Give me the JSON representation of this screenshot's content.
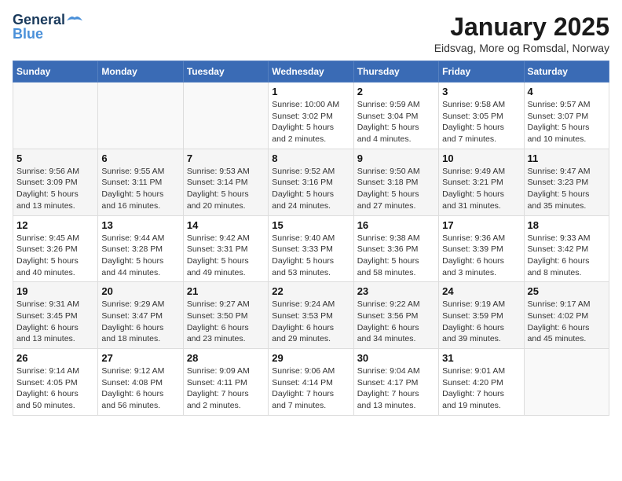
{
  "header": {
    "logo_line1": "General",
    "logo_line2": "Blue",
    "title": "January 2025",
    "subtitle": "Eidsvag, More og Romsdal, Norway"
  },
  "weekdays": [
    "Sunday",
    "Monday",
    "Tuesday",
    "Wednesday",
    "Thursday",
    "Friday",
    "Saturday"
  ],
  "weeks": [
    [
      {
        "day": "",
        "info": ""
      },
      {
        "day": "",
        "info": ""
      },
      {
        "day": "",
        "info": ""
      },
      {
        "day": "1",
        "info": "Sunrise: 10:00 AM\nSunset: 3:02 PM\nDaylight: 5 hours\nand 2 minutes."
      },
      {
        "day": "2",
        "info": "Sunrise: 9:59 AM\nSunset: 3:04 PM\nDaylight: 5 hours\nand 4 minutes."
      },
      {
        "day": "3",
        "info": "Sunrise: 9:58 AM\nSunset: 3:05 PM\nDaylight: 5 hours\nand 7 minutes."
      },
      {
        "day": "4",
        "info": "Sunrise: 9:57 AM\nSunset: 3:07 PM\nDaylight: 5 hours\nand 10 minutes."
      }
    ],
    [
      {
        "day": "5",
        "info": "Sunrise: 9:56 AM\nSunset: 3:09 PM\nDaylight: 5 hours\nand 13 minutes."
      },
      {
        "day": "6",
        "info": "Sunrise: 9:55 AM\nSunset: 3:11 PM\nDaylight: 5 hours\nand 16 minutes."
      },
      {
        "day": "7",
        "info": "Sunrise: 9:53 AM\nSunset: 3:14 PM\nDaylight: 5 hours\nand 20 minutes."
      },
      {
        "day": "8",
        "info": "Sunrise: 9:52 AM\nSunset: 3:16 PM\nDaylight: 5 hours\nand 24 minutes."
      },
      {
        "day": "9",
        "info": "Sunrise: 9:50 AM\nSunset: 3:18 PM\nDaylight: 5 hours\nand 27 minutes."
      },
      {
        "day": "10",
        "info": "Sunrise: 9:49 AM\nSunset: 3:21 PM\nDaylight: 5 hours\nand 31 minutes."
      },
      {
        "day": "11",
        "info": "Sunrise: 9:47 AM\nSunset: 3:23 PM\nDaylight: 5 hours\nand 35 minutes."
      }
    ],
    [
      {
        "day": "12",
        "info": "Sunrise: 9:45 AM\nSunset: 3:26 PM\nDaylight: 5 hours\nand 40 minutes."
      },
      {
        "day": "13",
        "info": "Sunrise: 9:44 AM\nSunset: 3:28 PM\nDaylight: 5 hours\nand 44 minutes."
      },
      {
        "day": "14",
        "info": "Sunrise: 9:42 AM\nSunset: 3:31 PM\nDaylight: 5 hours\nand 49 minutes."
      },
      {
        "day": "15",
        "info": "Sunrise: 9:40 AM\nSunset: 3:33 PM\nDaylight: 5 hours\nand 53 minutes."
      },
      {
        "day": "16",
        "info": "Sunrise: 9:38 AM\nSunset: 3:36 PM\nDaylight: 5 hours\nand 58 minutes."
      },
      {
        "day": "17",
        "info": "Sunrise: 9:36 AM\nSunset: 3:39 PM\nDaylight: 6 hours\nand 3 minutes."
      },
      {
        "day": "18",
        "info": "Sunrise: 9:33 AM\nSunset: 3:42 PM\nDaylight: 6 hours\nand 8 minutes."
      }
    ],
    [
      {
        "day": "19",
        "info": "Sunrise: 9:31 AM\nSunset: 3:45 PM\nDaylight: 6 hours\nand 13 minutes."
      },
      {
        "day": "20",
        "info": "Sunrise: 9:29 AM\nSunset: 3:47 PM\nDaylight: 6 hours\nand 18 minutes."
      },
      {
        "day": "21",
        "info": "Sunrise: 9:27 AM\nSunset: 3:50 PM\nDaylight: 6 hours\nand 23 minutes."
      },
      {
        "day": "22",
        "info": "Sunrise: 9:24 AM\nSunset: 3:53 PM\nDaylight: 6 hours\nand 29 minutes."
      },
      {
        "day": "23",
        "info": "Sunrise: 9:22 AM\nSunset: 3:56 PM\nDaylight: 6 hours\nand 34 minutes."
      },
      {
        "day": "24",
        "info": "Sunrise: 9:19 AM\nSunset: 3:59 PM\nDaylight: 6 hours\nand 39 minutes."
      },
      {
        "day": "25",
        "info": "Sunrise: 9:17 AM\nSunset: 4:02 PM\nDaylight: 6 hours\nand 45 minutes."
      }
    ],
    [
      {
        "day": "26",
        "info": "Sunrise: 9:14 AM\nSunset: 4:05 PM\nDaylight: 6 hours\nand 50 minutes."
      },
      {
        "day": "27",
        "info": "Sunrise: 9:12 AM\nSunset: 4:08 PM\nDaylight: 6 hours\nand 56 minutes."
      },
      {
        "day": "28",
        "info": "Sunrise: 9:09 AM\nSunset: 4:11 PM\nDaylight: 7 hours\nand 2 minutes."
      },
      {
        "day": "29",
        "info": "Sunrise: 9:06 AM\nSunset: 4:14 PM\nDaylight: 7 hours\nand 7 minutes."
      },
      {
        "day": "30",
        "info": "Sunrise: 9:04 AM\nSunset: 4:17 PM\nDaylight: 7 hours\nand 13 minutes."
      },
      {
        "day": "31",
        "info": "Sunrise: 9:01 AM\nSunset: 4:20 PM\nDaylight: 7 hours\nand 19 minutes."
      },
      {
        "day": "",
        "info": ""
      }
    ]
  ]
}
